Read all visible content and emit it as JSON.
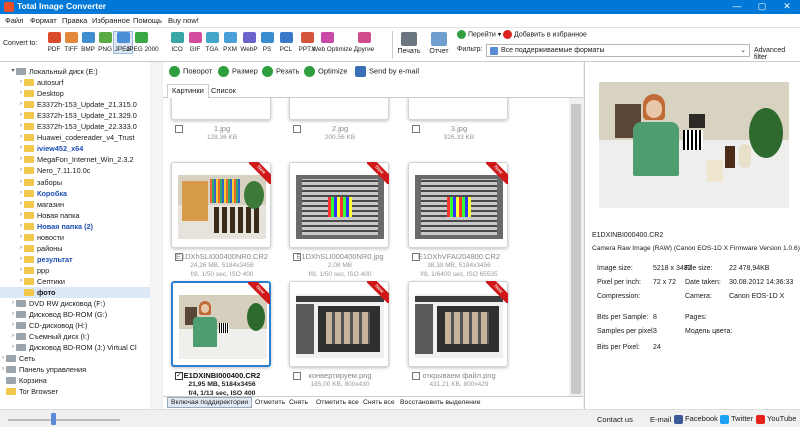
{
  "app": {
    "title": "Total Image Converter"
  },
  "window_controls": {
    "minimize": "—",
    "maximize": "▢",
    "close": "✕"
  },
  "menu": [
    "Файл",
    "Формат",
    "Правка",
    "Избранное",
    "Помощь",
    "Buy now!"
  ],
  "toolbar": {
    "convert_to_label": "Convert to:",
    "formats": [
      {
        "label": "PDF",
        "color": "#d94a2b"
      },
      {
        "label": "TIFF",
        "color": "#e2883a"
      },
      {
        "label": "BMP",
        "color": "#3e8ed0"
      },
      {
        "label": "PNG",
        "color": "#5bab44"
      },
      {
        "label": "JPEG",
        "color": "#4a8ed8"
      },
      {
        "label": "JPEG 2000",
        "color": "#38a845"
      },
      {
        "label": "ICO",
        "color": "#3aa5a5"
      },
      {
        "label": "GIF",
        "color": "#d24d9e"
      },
      {
        "label": "TGA",
        "color": "#46a6c8"
      },
      {
        "label": "PXM",
        "color": "#4a9fd8"
      },
      {
        "label": "WebP",
        "color": "#6a63c9"
      },
      {
        "label": "PS",
        "color": "#3a8ed0"
      },
      {
        "label": "PCL",
        "color": "#3a7ac9"
      },
      {
        "label": "PPTX",
        "color": "#d3543a"
      },
      {
        "label": "Web Optimize",
        "color": "#c94aa6"
      },
      {
        "label": "Другие",
        "color": "#d04d8c"
      }
    ],
    "print_label": "Печать",
    "report_label": "Отчет",
    "goto_label": "Перейти",
    "add_favorites_label": "Добавить в избранное",
    "filter_label": "Фильтр:",
    "filter_value": "Все поддерживаемые форматы",
    "advanced_filter_label": "Advanced filter"
  },
  "tree": {
    "items": [
      {
        "label": "Локальный диск (E:)",
        "level": 1,
        "expander": "▾",
        "icon": "drive-icon",
        "style": "normal"
      },
      {
        "label": "autosurf",
        "level": 2,
        "expander": "›",
        "icon": "folder-icon",
        "style": "normal"
      },
      {
        "label": "Desktop",
        "level": 2,
        "expander": "›",
        "icon": "folder-icon",
        "style": "normal"
      },
      {
        "label": "E3372h-153_Update_21.315.0",
        "level": 2,
        "expander": "›",
        "icon": "folder-icon",
        "style": "normal"
      },
      {
        "label": "E3372h-153_Update_21.329.0",
        "level": 2,
        "expander": "›",
        "icon": "folder-icon",
        "style": "normal"
      },
      {
        "label": "E3372h-153_Update_22.333.0",
        "level": 2,
        "expander": "›",
        "icon": "folder-icon",
        "style": "normal"
      },
      {
        "label": "Huawei_codereader_v4_Trust",
        "level": 2,
        "expander": "›",
        "icon": "folder-icon",
        "style": "normal"
      },
      {
        "label": "iview452_x64",
        "level": 2,
        "expander": "›",
        "icon": "folder-icon",
        "style": "blue"
      },
      {
        "label": "MegaFon_Internet_Win_2.3.2",
        "level": 2,
        "expander": "›",
        "icon": "folder-icon",
        "style": "normal"
      },
      {
        "label": "Nero_7.11.10.0c",
        "level": 2,
        "expander": "›",
        "icon": "folder-icon",
        "style": "normal"
      },
      {
        "label": "заборы",
        "level": 2,
        "expander": "›",
        "icon": "folder-icon",
        "style": "normal"
      },
      {
        "label": "Коробка",
        "level": 2,
        "expander": "›",
        "icon": "folder-icon",
        "style": "blue"
      },
      {
        "label": "магазин",
        "level": 2,
        "expander": "›",
        "icon": "folder-icon",
        "style": "normal"
      },
      {
        "label": "Новая папка",
        "level": 2,
        "expander": "›",
        "icon": "folder-icon",
        "style": "normal"
      },
      {
        "label": "Новая папка (2)",
        "level": 2,
        "expander": "›",
        "icon": "folder-icon",
        "style": "blue"
      },
      {
        "label": "новости",
        "level": 2,
        "expander": "›",
        "icon": "folder-icon",
        "style": "normal"
      },
      {
        "label": "районы",
        "level": 2,
        "expander": "›",
        "icon": "folder-icon",
        "style": "normal"
      },
      {
        "label": "результат",
        "level": 2,
        "expander": "›",
        "icon": "folder-icon",
        "style": "blue"
      },
      {
        "label": "ppp",
        "level": 2,
        "expander": "›",
        "icon": "folder-icon",
        "style": "normal"
      },
      {
        "label": "Септики",
        "level": 2,
        "expander": "›",
        "icon": "folder-icon",
        "style": "normal"
      },
      {
        "label": "фото",
        "level": 2,
        "expander": "",
        "icon": "folder-icon",
        "style": "bold"
      },
      {
        "label": "DVD RW дисковод (F:)",
        "level": 1,
        "expander": "›",
        "icon": "dvd-drive-icon",
        "style": "normal"
      },
      {
        "label": "Дисковод BD-ROM (G:)",
        "level": 1,
        "expander": "›",
        "icon": "bd-drive-icon",
        "style": "normal"
      },
      {
        "label": "CD-дисковод (H:)",
        "level": 1,
        "expander": "›",
        "icon": "cd-drive-icon",
        "style": "normal"
      },
      {
        "label": "Съемный диск (I:)",
        "level": 1,
        "expander": "›",
        "icon": "removable-drive-icon",
        "style": "normal"
      },
      {
        "label": "Дисковод BD-ROM (J:) Virtual Cl",
        "level": 1,
        "expander": "›",
        "icon": "bd-drive-icon",
        "style": "normal"
      },
      {
        "label": "Сеть",
        "level": 0,
        "expander": "›",
        "icon": "network-icon",
        "style": "normal"
      },
      {
        "label": "Панель управления",
        "level": 0,
        "expander": "›",
        "icon": "control-panel-icon",
        "style": "normal"
      },
      {
        "label": "Корзина",
        "level": 0,
        "expander": "",
        "icon": "recycle-bin-icon",
        "style": "normal"
      },
      {
        "label": "Tor Browser",
        "level": 0,
        "expander": "",
        "icon": "folder-icon",
        "style": "normal"
      }
    ]
  },
  "actions": [
    {
      "label": "Поворот",
      "icon": "rotate-icon",
      "color": "#2e9e3e"
    },
    {
      "label": "Размер",
      "icon": "resize-icon",
      "color": "#2e9e3e"
    },
    {
      "label": "Резать",
      "icon": "crop-icon",
      "color": "#2e9e3e"
    },
    {
      "label": "Optimize",
      "icon": "optimize-icon",
      "color": "#2e9e3e"
    },
    {
      "label": "Send by e-mail",
      "icon": "email-icon",
      "color": "#3a6fb8"
    }
  ],
  "view_tabs": [
    "Картинки",
    "Список"
  ],
  "thumbnails": [
    {
      "name": "1.jpg",
      "line2": "128,36 KB",
      "line3": "",
      "is_new": false,
      "checked": false,
      "selected": false,
      "kind": "partial"
    },
    {
      "name": "2.jpg",
      "line2": "200,56 KB",
      "line3": "",
      "is_new": false,
      "checked": false,
      "selected": false,
      "kind": "partial"
    },
    {
      "name": "3.jpg",
      "line2": "926,33 KB",
      "line3": "",
      "is_new": false,
      "checked": false,
      "selected": false,
      "kind": "partial"
    },
    {
      "name": "E1DXhSLI000400NR0.CR2",
      "line2": "24,26 MB, 5184x3456",
      "line3": "f/8, 1/50 sec, ISO 400",
      "is_new": true,
      "checked": false,
      "selected": false,
      "kind": "still"
    },
    {
      "name": "E1DXhSLI000400NR0.jpg",
      "line2": "2,08 MB",
      "line3": "f/8, 1/50 sec, ISO 400",
      "is_new": true,
      "checked": false,
      "selected": false,
      "kind": "chart"
    },
    {
      "name": "E1DXhVFAI204800.CR2",
      "line2": "38,39 MB, 5184x3456",
      "line3": "f/8, 1/6400 sec, ISO 65535",
      "is_new": true,
      "checked": false,
      "selected": false,
      "kind": "chart"
    },
    {
      "name": "E1DXINBI000400.CR2",
      "line2": "21,95 MB, 5184x3456",
      "line3": "f/4, 1/13 sec, ISO 400",
      "is_new": true,
      "checked": true,
      "selected": true,
      "kind": "portrait"
    },
    {
      "name": "конвертируем.png",
      "line2": "185,00 KB, 800x430",
      "line3": "",
      "is_new": true,
      "checked": false,
      "selected": false,
      "kind": "screen"
    },
    {
      "name": "открываем файл.png",
      "line2": "431,21 KB, 800x429",
      "line3": "",
      "is_new": true,
      "checked": false,
      "selected": false,
      "kind": "screen"
    }
  ],
  "new_badge": "New",
  "bottom_actions": [
    "Включая поддиректории",
    "Отметить",
    "Снять",
    "Отметить все",
    "Снять все",
    "Восстановить выделение"
  ],
  "preview": {
    "filename": "E1DXINBI000400.CR2",
    "description": "Camera Raw Image (RAW) (Canon EOS-1D X Firmware Version 1.0.6)",
    "props": [
      {
        "label": "Image size:",
        "value": "5218 x 3482"
      },
      {
        "label": "File size:",
        "value": "22 478,94KB"
      },
      {
        "label": "Pixel per inch:",
        "value": "72 x 72"
      },
      {
        "label": "Date taken:",
        "value": "30.08.2012 14:36:33"
      },
      {
        "label": "Compression:",
        "value": ""
      },
      {
        "label": "Camera:",
        "value": "Canon EOS-1D X"
      },
      {
        "label": "Bits per Sample:",
        "value": "8"
      },
      {
        "label": "Pages:",
        "value": ""
      },
      {
        "label": "Samples per pixel:",
        "value": "3"
      },
      {
        "label": "Модель цвета:",
        "value": ""
      },
      {
        "label": "Bits per Pixel:",
        "value": "24"
      }
    ]
  },
  "footer": {
    "contact": "Contact us",
    "email": "E-mail",
    "facebook": "Facebook",
    "twitter": "Twitter",
    "youtube": "YouTube",
    "zoom_percent": 40
  },
  "colors": {
    "titlebar": "#0078d7",
    "selection": "#2b7fd1",
    "new_ribbon": "#d01818",
    "folder": "#f2c84b"
  }
}
